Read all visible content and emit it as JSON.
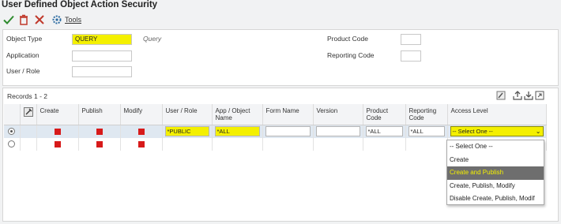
{
  "page": {
    "title": "User Defined Object Action Security"
  },
  "toolbar": {
    "ok_icon": "check-icon",
    "delete_icon": "trash-icon",
    "cancel_icon": "close-icon",
    "tools_icon": "gear-icon",
    "tools_label": "Tools"
  },
  "form": {
    "object_type_label": "Object Type",
    "object_type_value": "QUERY",
    "object_type_description": "Query",
    "application_label": "Application",
    "application_value": "",
    "user_role_label": "User / Role",
    "user_role_value": "",
    "product_code_label": "Product Code",
    "product_code_value": "",
    "reporting_code_label": "Reporting Code",
    "reporting_code_value": ""
  },
  "grid": {
    "records_label": "Records 1 - 2",
    "columns": {
      "create": "Create",
      "publish": "Publish",
      "modify": "Modify",
      "user_role": "User / Role",
      "app_object_name": "App / Object Name",
      "form_name": "Form Name",
      "version": "Version",
      "product_code": "Product Code",
      "reporting_code": "Reporting Code",
      "access_level": "Access Level"
    },
    "rows": [
      {
        "selected": true,
        "user_role": "*PUBLIC",
        "app_object_name": "*ALL",
        "form_name": "",
        "version": "",
        "product_code": "*ALL",
        "reporting_code": "*ALL",
        "access_level": "-- Select One --"
      },
      {
        "selected": false
      }
    ]
  },
  "access_level_options": [
    "-- Select One --",
    "Create",
    "Create and Publish",
    "Create, Publish, Modify",
    "Disable Create, Publish, Modif"
  ],
  "colors": {
    "highlight": "#f4f000",
    "checkbox_red": "#d71a1a",
    "selected_row": "#dfe8f1",
    "dropdown_active_bg": "#6e6e6e"
  }
}
